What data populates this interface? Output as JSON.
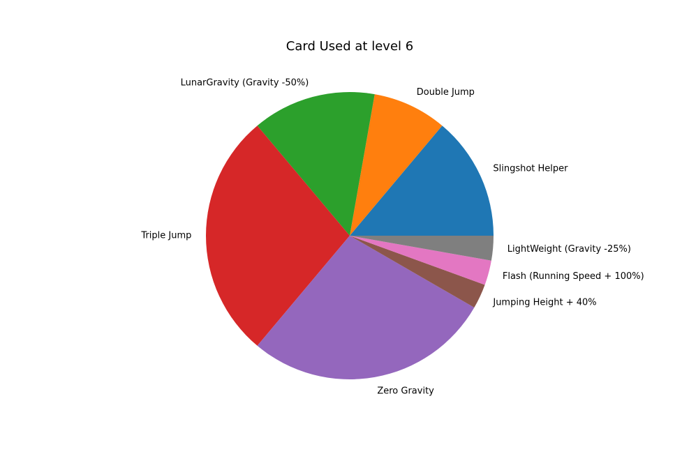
{
  "chart_data": {
    "type": "pie",
    "title": "Card Used at level 6",
    "start_angle_deg": 0,
    "direction": "counterclockwise",
    "slices": [
      {
        "label": "Slingshot Helper",
        "value": 5,
        "color": "#1f77b4"
      },
      {
        "label": "Double Jump",
        "value": 3,
        "color": "#ff7f0e"
      },
      {
        "label": "LunarGravity (Gravity -50%)",
        "value": 5,
        "color": "#2ca02c"
      },
      {
        "label": "Triple Jump",
        "value": 10,
        "color": "#d62728"
      },
      {
        "label": "Zero Gravity",
        "value": 10,
        "color": "#9467bd"
      },
      {
        "label": "Jumping Height + 40%",
        "value": 1,
        "color": "#8c564b"
      },
      {
        "label": "Flash (Running Speed + 100%)",
        "value": 1,
        "color": "#e377c2"
      },
      {
        "label": "LightWeight (Gravity -25%)",
        "value": 1,
        "color": "#7f7f7f"
      }
    ]
  }
}
